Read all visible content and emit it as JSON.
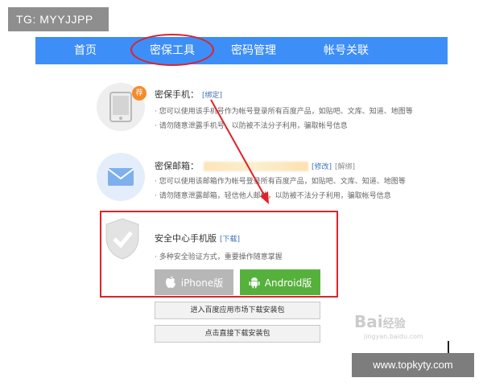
{
  "overlay": {
    "tg_label": "TG: MYYJJPP",
    "site_label": "www.topkyty.com",
    "watermark": "Baiéç»éª",
    "watermark_sub": "jingyan.baidu.com"
  },
  "nav": {
    "items": [
      {
        "label": "首页"
      },
      {
        "label": "密保工具"
      },
      {
        "label": "密码管理"
      },
      {
        "label": "帐号关联"
      }
    ]
  },
  "phone": {
    "title": "密保手机：",
    "link": "[绑定]",
    "badge": "荐",
    "desc1": "· 您可以使用该手机号作为帐号登录所有百度产品，如贴吧、文库、知道、地图等",
    "desc2": "· 请勿随意泄露手机号，以防被不法分子利用，骗取帐号信息"
  },
  "mail": {
    "title": "密保邮箱：",
    "link_edit": "[修改]",
    "link_unbind": "[解绑]",
    "desc1": "· 您可以使用该邮箱作为帐号登录所有百度产品，如贴吧、文库、知道、地图等",
    "desc2": "· 请勿随意泄露邮箱，轻信他人邮件，以防被不法分子利用，骗取帐号信息"
  },
  "app": {
    "title": "安全中心手机版",
    "link": "[下载]",
    "desc": "· 多种安全验证方式，重要操作随意掌握",
    "iphone_label": "iPhone版",
    "android_label": "Android版",
    "market_label": "进入百度应用市场下载安装包",
    "direct_label": "点击直接下载安装包"
  },
  "colors": {
    "nav_bg": "#3d8ef7",
    "highlight_red": "#e0212a",
    "android_green": "#56b13c",
    "iphone_grey": "#b7b7b7",
    "badge_orange": "#f58b2b"
  }
}
